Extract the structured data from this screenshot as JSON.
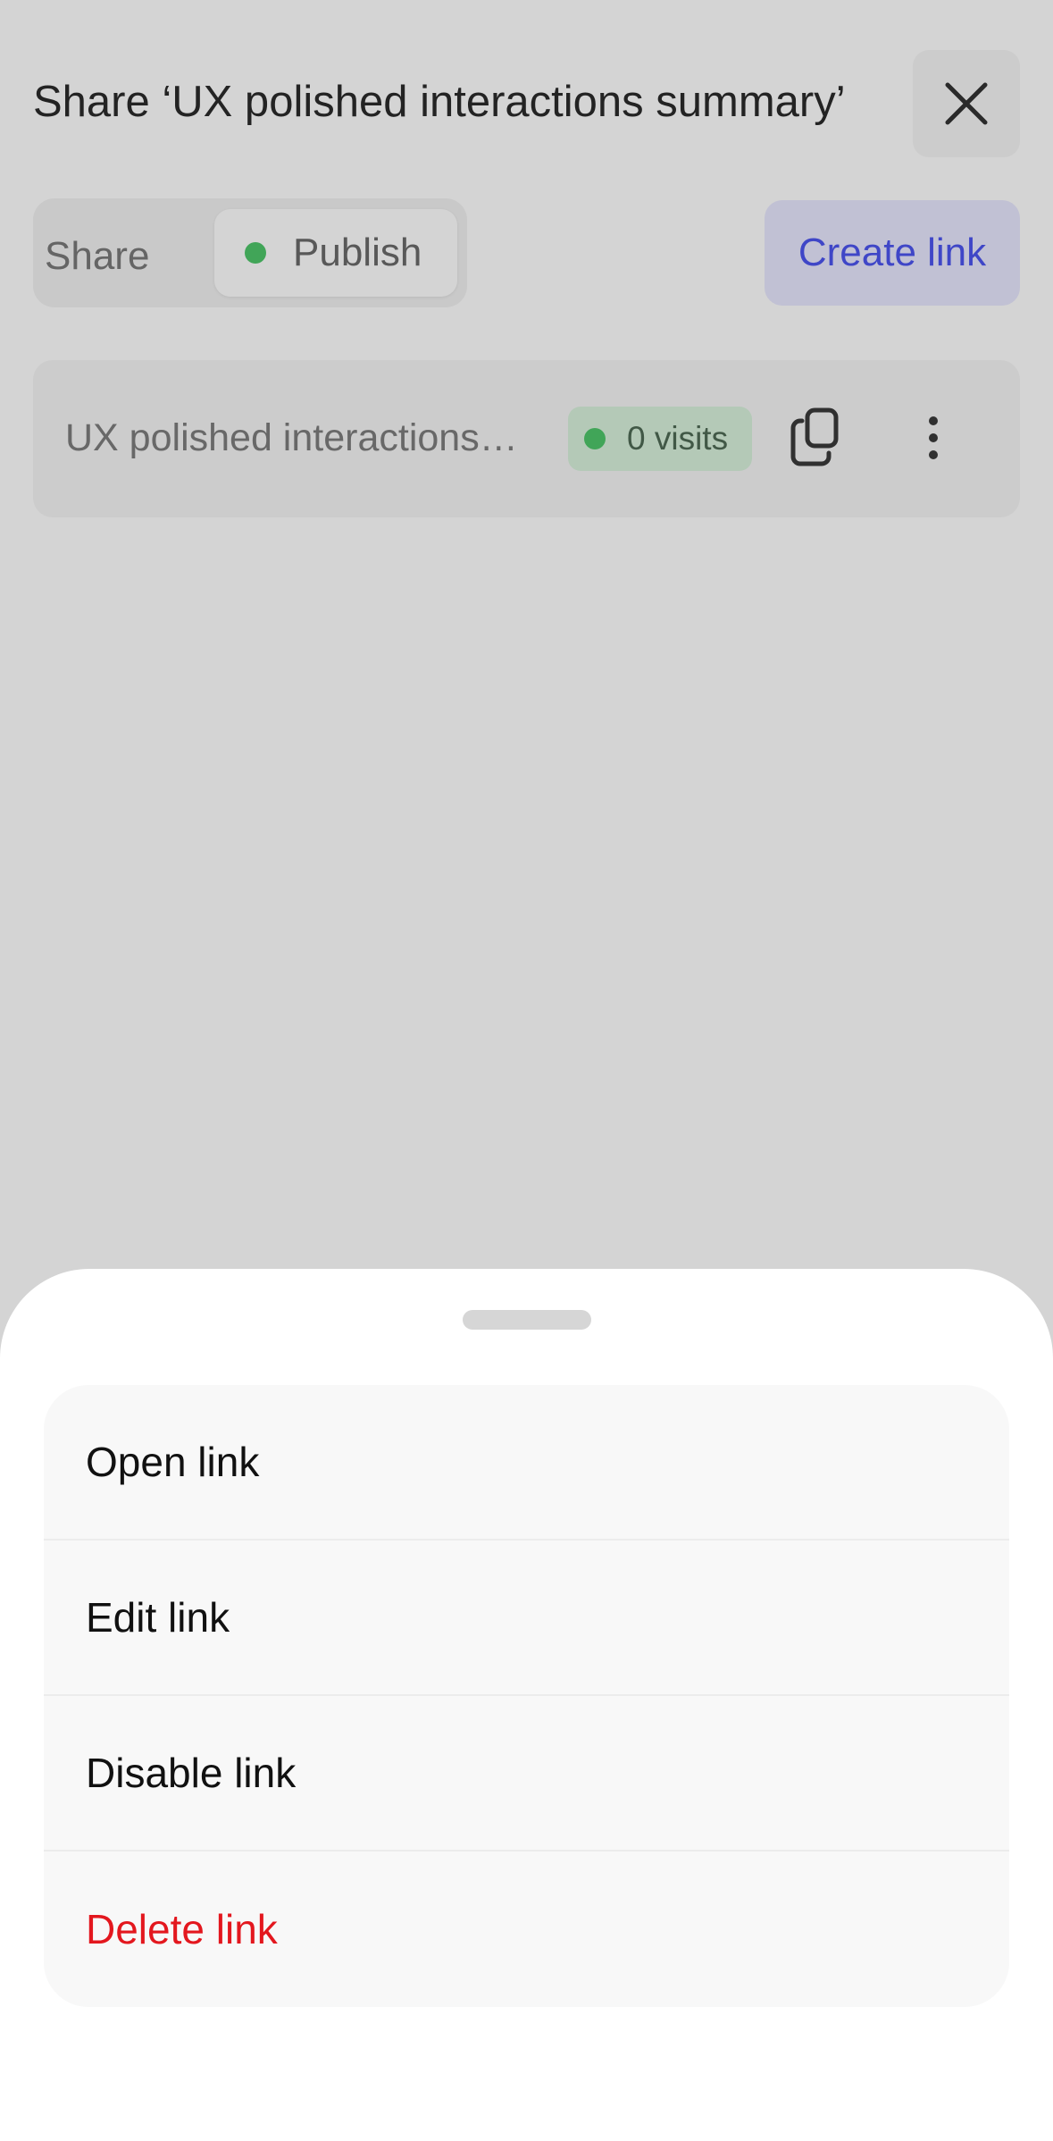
{
  "dialog": {
    "title": "Share ‘UX polished interactions summary’",
    "close_icon": "close-icon",
    "tabs": [
      {
        "label": "Share",
        "selected": false
      },
      {
        "label": "Publish",
        "selected": true,
        "status_color": "#4fc76a"
      }
    ],
    "create_link_label": "Create link",
    "accent_color": "#4c55f0"
  },
  "links": [
    {
      "name": "UX polished interactions…",
      "visits": "0 visits",
      "copy_icon": "copy-icon",
      "more_icon": "more-vertical-icon"
    }
  ],
  "sheet": {
    "items": [
      {
        "label": "Open link"
      },
      {
        "label": "Edit link"
      },
      {
        "label": "Disable link"
      },
      {
        "label": "Delete link",
        "danger": true,
        "color": "#e3171e"
      }
    ]
  }
}
